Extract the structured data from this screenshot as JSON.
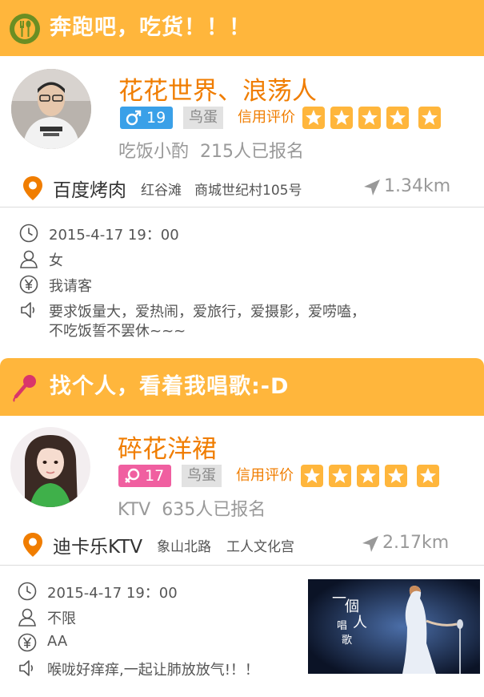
{
  "colors": {
    "accent_orange": "#ffb63c",
    "name_orange": "#f07d00",
    "male_blue": "#3aa0e8",
    "female_pink": "#f05fa0",
    "location_orange": "#f07d00"
  },
  "events": [
    {
      "header": {
        "icon": "fork-spoon-icon",
        "title": "奔跑吧，吃货！！！"
      },
      "host": {
        "name": "花花世界、浪荡人",
        "gender": "male",
        "gender_icon": "male-symbol-icon",
        "age": "19",
        "level": "鸟蛋",
        "credit_label": "信用评价",
        "credit_stars": 5
      },
      "category": "吃饭小酌",
      "signup": "215人已报名",
      "venue": "百度烤肉",
      "district": "红谷滩",
      "address": "商城世纪村105号",
      "distance": "1.34km",
      "datetime": "2015-4-17  19：00",
      "gender_req": "女",
      "payment": "我请客",
      "description_line1": "要求饭量大，爱热闹，爱旅行，爱摄影，爱唠嗑，",
      "description_line2": "不吃饭誓不罢休~~~"
    },
    {
      "header": {
        "icon": "microphone-icon",
        "title": "找个人，看着我唱歌:-D"
      },
      "host": {
        "name": "碎花洋裙",
        "gender": "female",
        "gender_icon": "female-symbol-icon",
        "age": "17",
        "level": "鸟蛋",
        "credit_label": "信用评价",
        "credit_stars": 5
      },
      "category": "KTV",
      "signup": "635人已报名",
      "venue": "迪卡乐KTV",
      "district": "象山北路",
      "address": "工人文化宫",
      "distance": "2.17km",
      "datetime": "2015-4-17  19：00",
      "gender_req": "不限",
      "payment": "AA",
      "description_line1": "喉咙好痒痒,一起让肺放放气!！！",
      "photo_caption": "一個人唱歌"
    }
  ]
}
